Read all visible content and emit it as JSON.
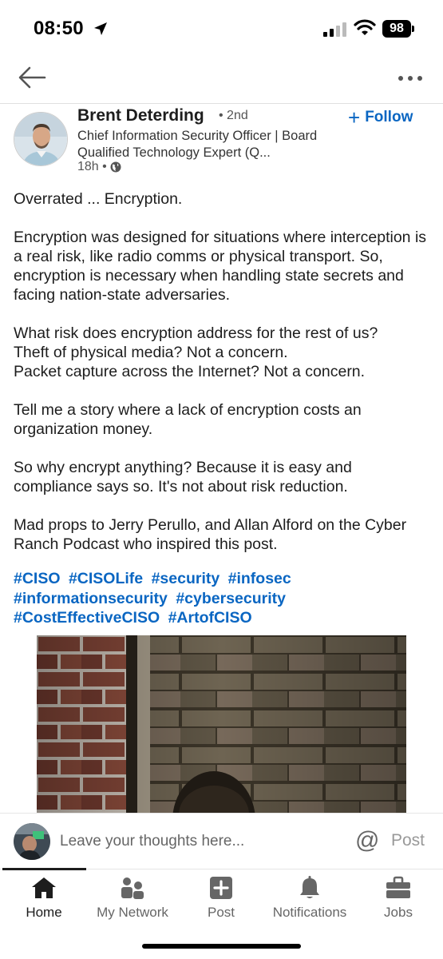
{
  "status": {
    "time": "08:50",
    "battery": "98"
  },
  "header": {
    "back_icon": "arrow-left-icon",
    "more_icon": "more-horizontal-icon"
  },
  "author": {
    "name": "Brent Deterding",
    "degree": "• 2nd",
    "headline": "Chief Information Security Officer | Board Qualified Technology Expert (Q...",
    "time_ago": "18h •",
    "visibility_icon": "globe-icon",
    "follow_label": "Follow"
  },
  "post": {
    "paragraphs": [
      "Overrated ... Encryption.",
      "Encryption was designed for situations where interception is a real risk, like radio comms or physical transport. So, encryption is necessary when handling state secrets and facing nation-state adversaries.",
      "What risk does encryption address for the rest of us?\nTheft of physical media? Not a concern.\nPacket capture across the Internet? Not a concern.",
      "Tell me a story where a lack of encryption costs an organization money.",
      "So why encrypt anything? Because it is easy and compliance says so. It's not about risk reduction.",
      "Mad props to Jerry Perullo, and Allan Alford on the Cyber Ranch Podcast who inspired this post."
    ],
    "hashtags": [
      "#CISO",
      "#CISOLife",
      "#security",
      "#infosec",
      "#informationsecurity",
      "#cybersecurity",
      "#CostEffectiveCISO",
      "#ArtofCISO"
    ]
  },
  "comment": {
    "placeholder": "Leave your thoughts here...",
    "mention_symbol": "@",
    "post_label": "Post"
  },
  "tabs": [
    {
      "label": "Home",
      "icon": "home-icon",
      "active": true
    },
    {
      "label": "My Network",
      "icon": "network-icon",
      "active": false
    },
    {
      "label": "Post",
      "icon": "plus-square-icon",
      "active": false
    },
    {
      "label": "Notifications",
      "icon": "bell-icon",
      "active": false
    },
    {
      "label": "Jobs",
      "icon": "briefcase-icon",
      "active": false
    }
  ],
  "colors": {
    "accent": "#0a66c2",
    "text": "#1d1d1d",
    "muted": "#666666"
  }
}
